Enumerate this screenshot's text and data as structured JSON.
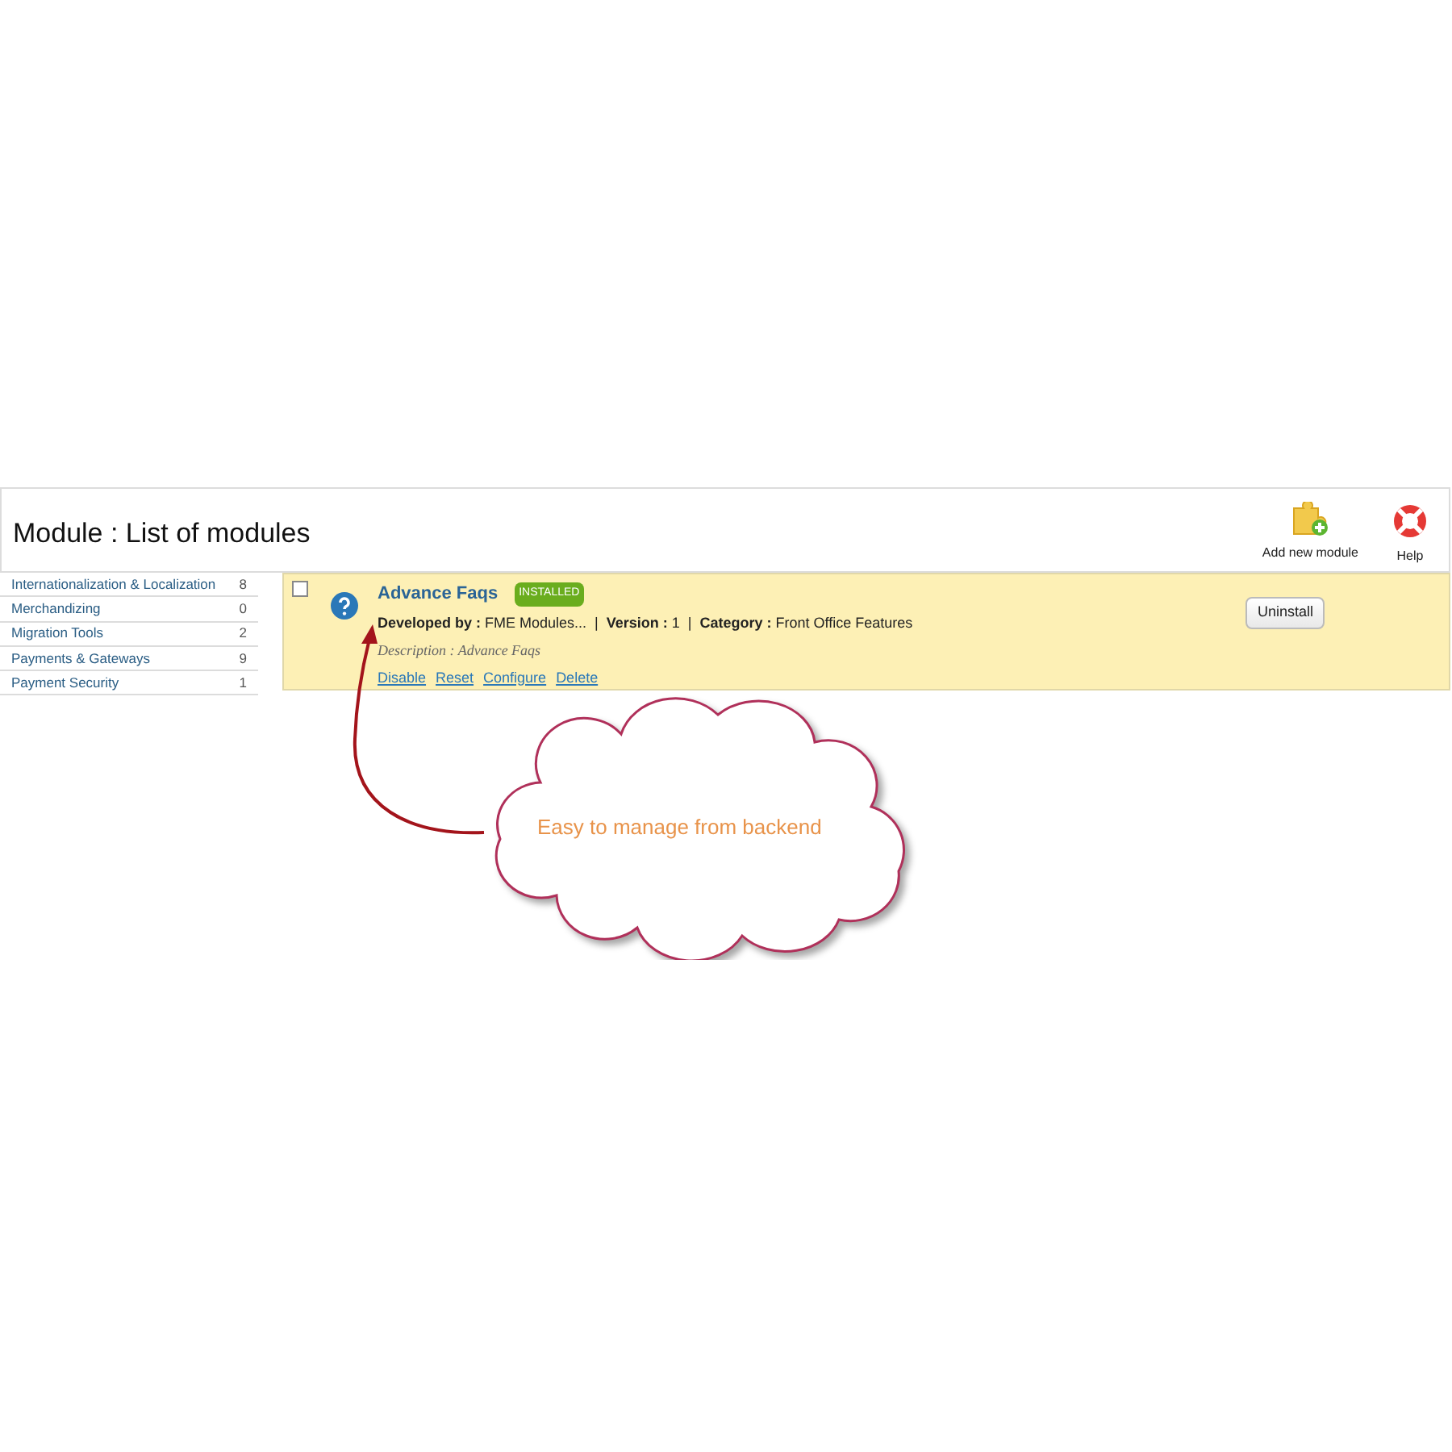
{
  "header": {
    "title": "Module : List of modules",
    "tools": [
      {
        "kind": "add",
        "label": "Add new module"
      },
      {
        "kind": "help",
        "label": "Help"
      }
    ]
  },
  "categories": [
    {
      "name": "Internationalization & Localization",
      "count": "8"
    },
    {
      "name": "Merchandizing",
      "count": "0"
    },
    {
      "name": "Migration Tools",
      "count": "2"
    },
    {
      "name": "Payments & Gateways",
      "count": "9"
    },
    {
      "name": "Payment Security",
      "count": "1"
    }
  ],
  "modules": [
    {
      "kind": "full",
      "name": "Advance Faqs",
      "badge": "INSTALLED",
      "checked": false,
      "meta": "**Developed by :** FME Modules...  |  **Version :** 1  |  **Category :** Front Office Features",
      "description": "Description : Advance Faqs",
      "actions": [
        "Disable",
        "Reset",
        "Configure",
        "Delete"
      ],
      "button": "Uninstall",
      "highlighted": true
    }
  ],
  "callout": {
    "text": "Easy to manage from backend"
  }
}
